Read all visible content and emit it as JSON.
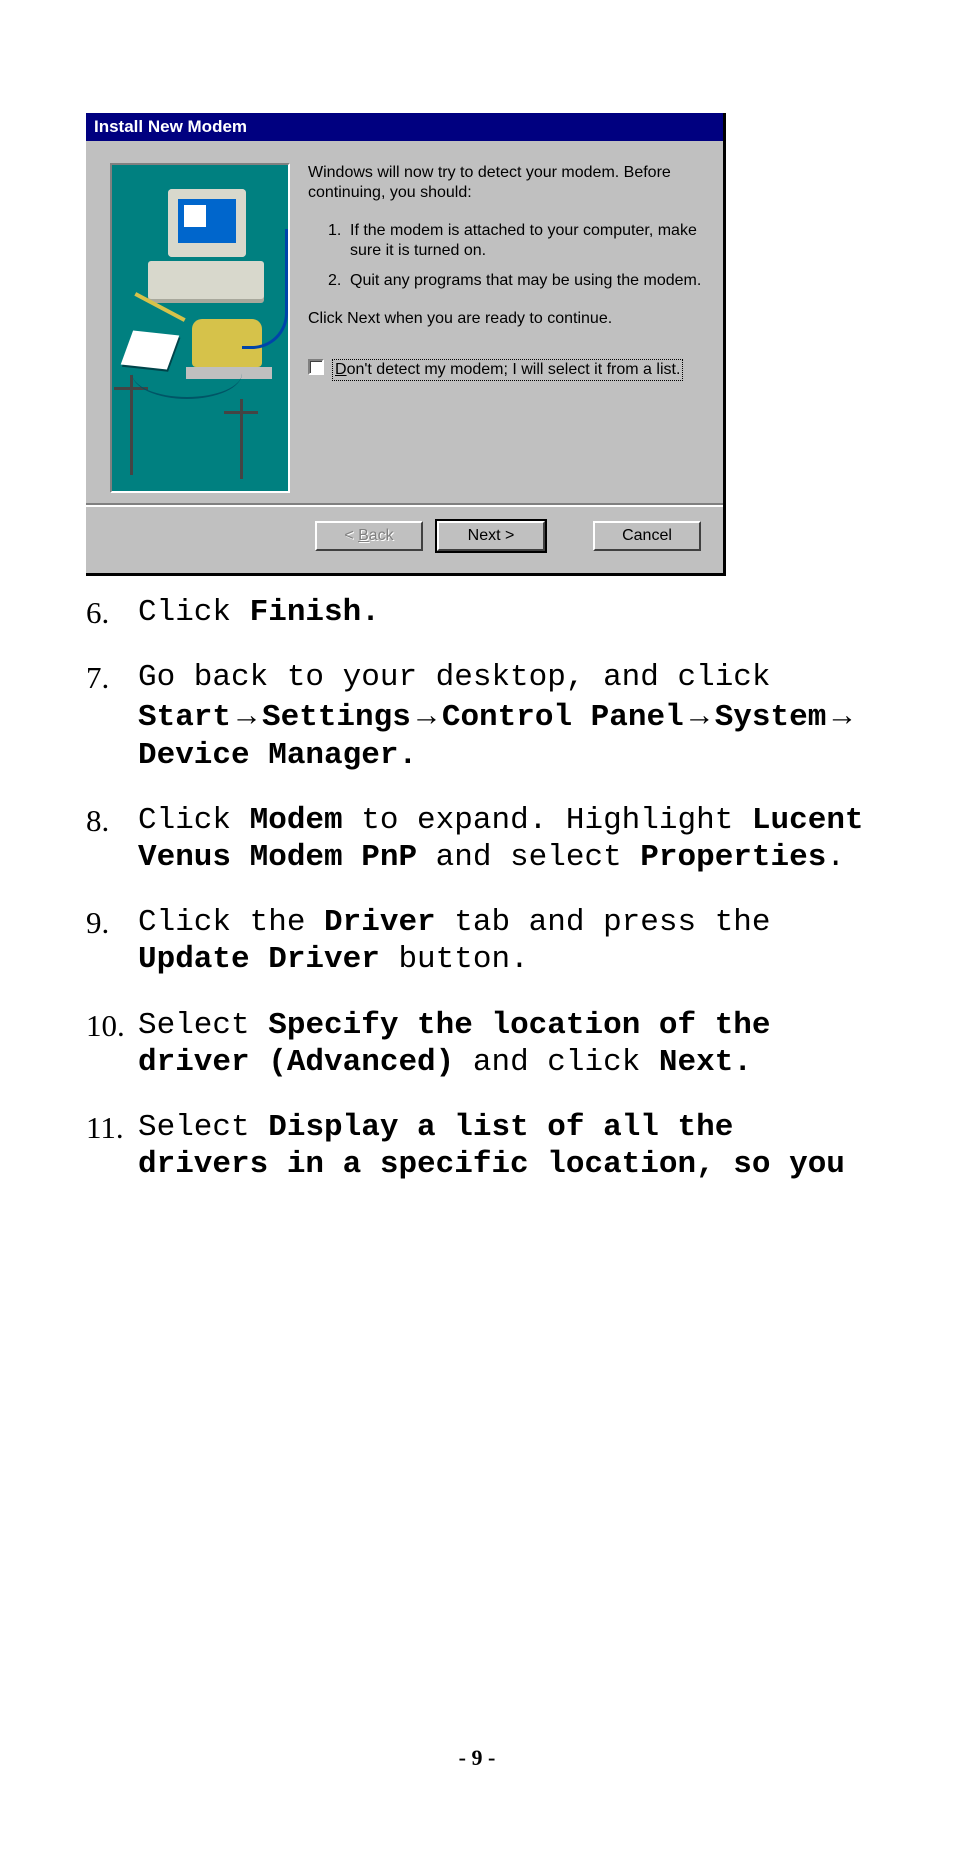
{
  "dialog": {
    "title": "Install New Modem",
    "intro": "Windows will now try to detect your modem.  Before continuing, you should:",
    "steps": [
      {
        "n": "1.",
        "text": "If the modem is attached to your computer, make sure it is turned on."
      },
      {
        "n": "2.",
        "text": "Quit any programs that may be using the modem."
      }
    ],
    "continue_text": "Click Next when you are ready to continue.",
    "checkbox_label_pre": "D",
    "checkbox_label_rest": "on't detect my modem; I will select it from a list.",
    "buttons": {
      "back_underline": "B",
      "back_rest": "ack",
      "back_prefix": "< ",
      "next": "Next >",
      "cancel": "Cancel"
    }
  },
  "instructions": {
    "i6": {
      "num": "6.",
      "pre": "Click ",
      "finish": "Finish."
    },
    "i7": {
      "num": "7.",
      "line1": "Go back to your desktop, and click",
      "bold": "Start→Settings→Control Panel→System→ Device Manager."
    },
    "i8": {
      "num": "8.",
      "a": "Click ",
      "modem": "Modem",
      "b": " to expand. Highlight ",
      "lucent": "Lucent Venus Modem PnP",
      "c": " and select ",
      "props": "Properties",
      "d": "."
    },
    "i9": {
      "num": "9.",
      "a": "Click the ",
      "driver": "Driver",
      "b": " tab and press the ",
      "update": "Update Driver",
      "c": " button."
    },
    "i10": {
      "num": "10.",
      "a": "Select ",
      "spec": "Specify the location of the driver (Advanced)",
      "b": " and click ",
      "next": "Next."
    },
    "i11": {
      "num": "11.",
      "a": "Select ",
      "disp": "Display a list of all the drivers in a specific location, so you"
    }
  },
  "page_number": "- 9 -"
}
